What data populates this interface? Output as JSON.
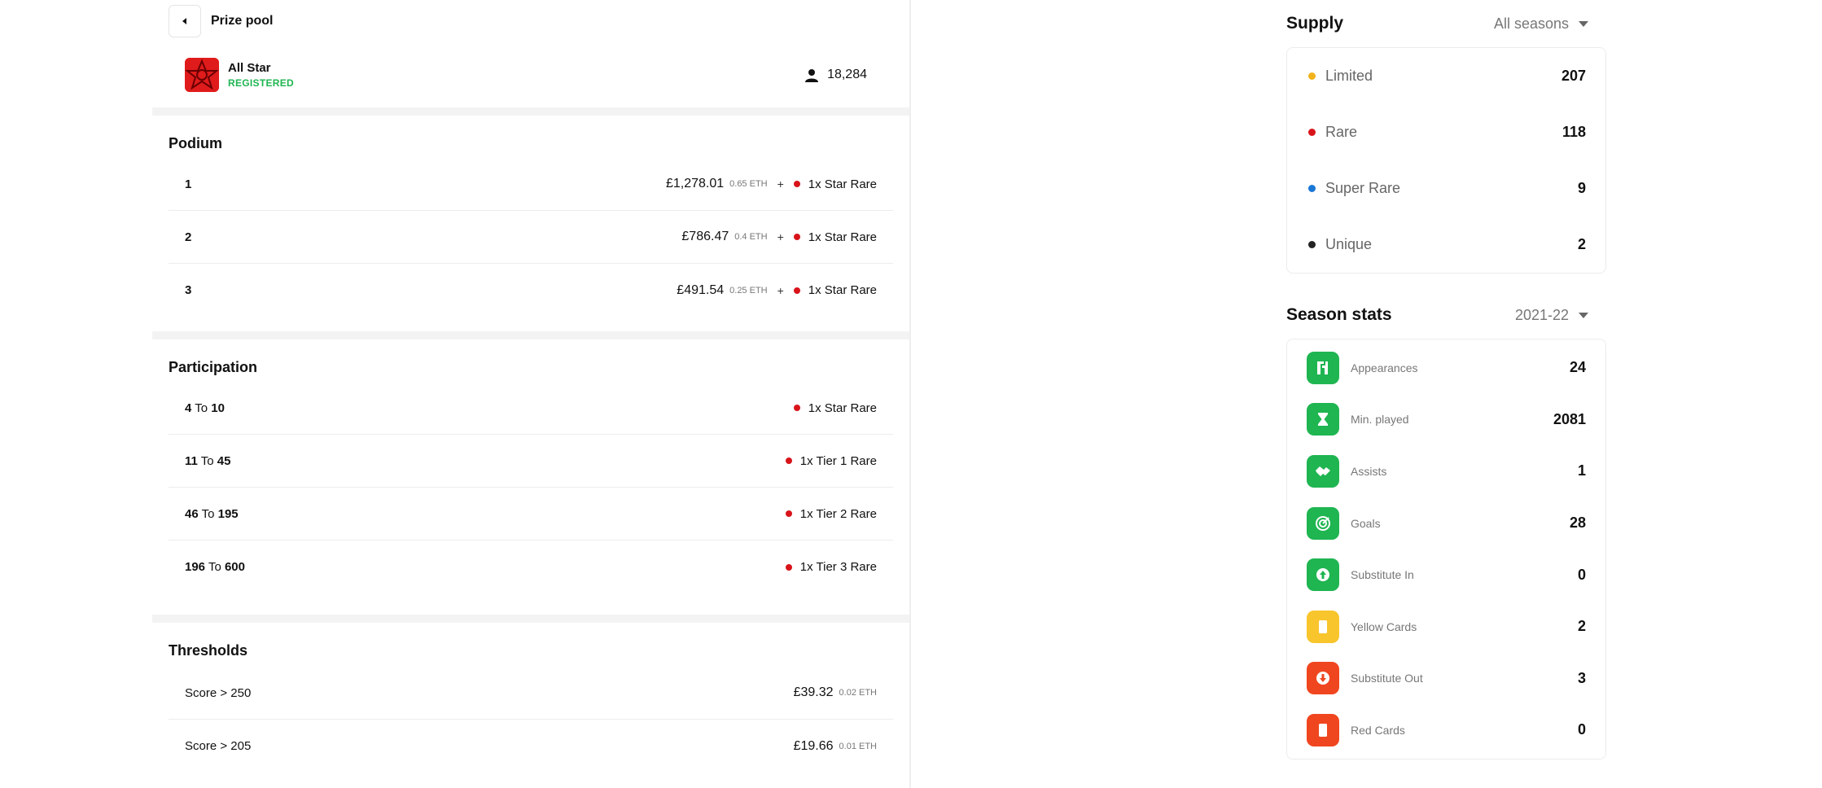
{
  "header": {
    "title": "Prize pool"
  },
  "competition": {
    "name": "All Star",
    "status": "REGISTERED",
    "participants": "18,284"
  },
  "podium": {
    "title": "Podium",
    "rows": [
      {
        "rank": "1",
        "money": "£1,278.01",
        "eth": "0.65 ETH",
        "plus": "+",
        "reward": "1x Star Rare"
      },
      {
        "rank": "2",
        "money": "£786.47",
        "eth": "0.4 ETH",
        "plus": "+",
        "reward": "1x Star Rare"
      },
      {
        "rank": "3",
        "money": "£491.54",
        "eth": "0.25 ETH",
        "plus": "+",
        "reward": "1x Star Rare"
      }
    ]
  },
  "participation": {
    "title": "Participation",
    "to_word": "To",
    "rows": [
      {
        "from": "4",
        "to": "10",
        "reward": "1x Star Rare"
      },
      {
        "from": "11",
        "to": "45",
        "reward": "1x Tier 1 Rare"
      },
      {
        "from": "46",
        "to": "195",
        "reward": "1x Tier 2 Rare"
      },
      {
        "from": "196",
        "to": "600",
        "reward": "1x Tier 3 Rare"
      }
    ]
  },
  "thresholds": {
    "title": "Thresholds",
    "rows": [
      {
        "label": "Score > 250",
        "money": "£39.32",
        "eth": "0.02 ETH"
      },
      {
        "label": "Score > 205",
        "money": "£19.66",
        "eth": "0.01 ETH"
      }
    ]
  },
  "supply": {
    "title": "Supply",
    "filter": "All seasons",
    "items": [
      {
        "name": "Limited",
        "value": "207",
        "color": "#f2b21b"
      },
      {
        "name": "Rare",
        "value": "118",
        "color": "#d8141a"
      },
      {
        "name": "Super Rare",
        "value": "9",
        "color": "#1a77d6"
      },
      {
        "name": "Unique",
        "value": "2",
        "color": "#222222"
      }
    ]
  },
  "season_stats": {
    "title": "Season stats",
    "filter": "2021-22",
    "items": [
      {
        "name": "Appearances",
        "value": "24",
        "color": "#1fb551",
        "icon": "appearances-icon"
      },
      {
        "name": "Min. played",
        "value": "2081",
        "color": "#1fb551",
        "icon": "hourglass-icon"
      },
      {
        "name": "Assists",
        "value": "1",
        "color": "#1fb551",
        "icon": "handshake-icon"
      },
      {
        "name": "Goals",
        "value": "28",
        "color": "#1fb551",
        "icon": "target-icon"
      },
      {
        "name": "Substitute In",
        "value": "0",
        "color": "#1fb551",
        "icon": "arrow-up-circle-icon"
      },
      {
        "name": "Yellow Cards",
        "value": "2",
        "color": "#f8c52c",
        "icon": "yellow-card-icon"
      },
      {
        "name": "Substitute Out",
        "value": "3",
        "color": "#f0461f",
        "icon": "arrow-down-circle-icon"
      },
      {
        "name": "Red Cards",
        "value": "0",
        "color": "#f0461f",
        "icon": "red-card-icon"
      }
    ]
  },
  "colors": {
    "rare_dot": "#d8141a",
    "registered": "#1fb551"
  }
}
